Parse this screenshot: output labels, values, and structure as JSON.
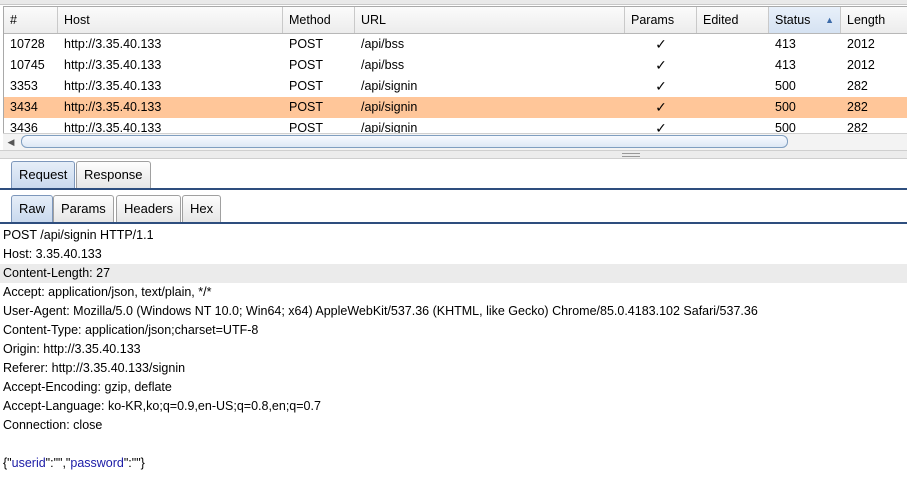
{
  "table": {
    "columns": [
      "#",
      "Host",
      "Method",
      "URL",
      "Params",
      "Edited",
      "Status",
      "Length"
    ],
    "sorted_column": "Status",
    "rows": [
      {
        "num": "10728",
        "host": "http://3.35.40.133",
        "method": "POST",
        "url": "/api/bss",
        "params": "✓",
        "edited": "",
        "status": "413",
        "length": "2012"
      },
      {
        "num": "10745",
        "host": "http://3.35.40.133",
        "method": "POST",
        "url": "/api/bss",
        "params": "✓",
        "edited": "",
        "status": "413",
        "length": "2012"
      },
      {
        "num": "3353",
        "host": "http://3.35.40.133",
        "method": "POST",
        "url": "/api/signin",
        "params": "✓",
        "edited": "",
        "status": "500",
        "length": "282"
      },
      {
        "num": "3434",
        "host": "http://3.35.40.133",
        "method": "POST",
        "url": "/api/signin",
        "params": "✓",
        "edited": "",
        "status": "500",
        "length": "282"
      },
      {
        "num": "3436",
        "host": "http://3.35.40.133",
        "method": "POST",
        "url": "/api/signin",
        "params": "✓",
        "edited": "",
        "status": "500",
        "length": "282"
      }
    ]
  },
  "tabs_top": [
    "Request",
    "Response"
  ],
  "tabs_sub": [
    "Raw",
    "Params",
    "Headers",
    "Hex"
  ],
  "request": {
    "lines": [
      "POST /api/signin HTTP/1.1",
      "Host: 3.35.40.133",
      "Content-Length: 27",
      "Accept: application/json, text/plain, */*",
      "User-Agent: Mozilla/5.0 (Windows NT 10.0; Win64; x64) AppleWebKit/537.36 (KHTML, like Gecko) Chrome/85.0.4183.102 Safari/537.36",
      "Content-Type: application/json;charset=UTF-8",
      "Origin: http://3.35.40.133",
      "Referer: http://3.35.40.133/signin",
      "Accept-Encoding: gzip, deflate",
      "Accept-Language: ko-KR,ko;q=0.9,en-US;q=0.8,en;q=0.7",
      "Connection: close"
    ],
    "body": {
      "open": "{\"",
      "key1": "userid",
      "sep1": "\":\"\",\"",
      "key2": "password",
      "close": "\":\"\"}"
    }
  }
}
